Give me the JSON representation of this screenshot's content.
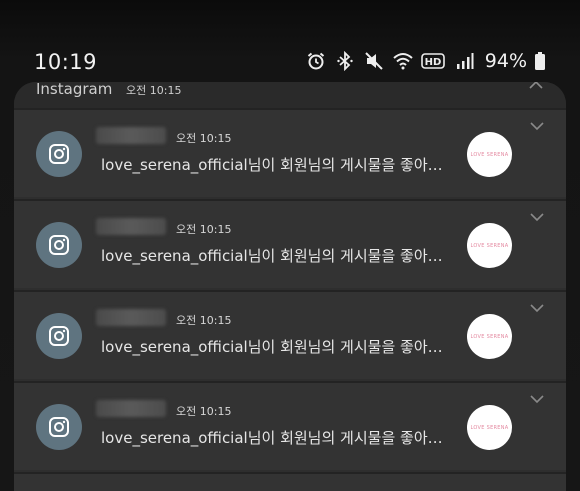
{
  "status_bar": {
    "time": "10:19",
    "battery_percent": "94%",
    "icons": [
      "alarm-icon",
      "bluetooth-icon",
      "mute-icon",
      "wifi-icon",
      "hd-voice-icon",
      "signal-icon",
      "battery-icon"
    ]
  },
  "group": {
    "app_name": "Instagram",
    "time": "오전 10:15"
  },
  "notifications": [
    {
      "time": "오전 10:15",
      "message": "love_serena_official님이 회원님의 게시물을 좋아…",
      "thumb_text": "LOVE SERENA"
    },
    {
      "time": "오전 10:15",
      "message": "love_serena_official님이 회원님의 게시물을 좋아…",
      "thumb_text": "LOVE SERENA"
    },
    {
      "time": "오전 10:15",
      "message": "love_serena_official님이 회원님의 게시물을 좋아…",
      "thumb_text": "LOVE SERENA"
    },
    {
      "time": "오전 10:15",
      "message": "love_serena_official님이 회원님의 게시물을 좋아…",
      "thumb_text": "LOVE SERENA"
    }
  ],
  "colors": {
    "card_bg": "#333333",
    "app_icon_bg": "#5f7480",
    "thumb_text": "#e48aa1"
  }
}
